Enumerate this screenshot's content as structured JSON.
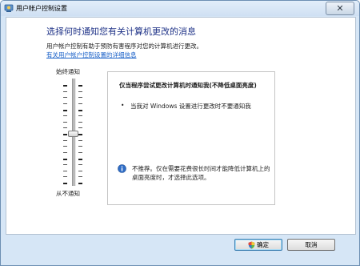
{
  "window": {
    "title": "用户帐户控制设置"
  },
  "titlebar": {
    "close_symbol": "✕"
  },
  "main": {
    "heading": "选择何时通知您有关计算机更改的消息",
    "description": "用户帐户控制有助于预防有害程序对您的计算机进行更改。",
    "more_link": "有关用户帐户控制设置的详细信息"
  },
  "slider": {
    "top_label": "始终通知",
    "bottom_label": "从不通知",
    "levels": 4,
    "current_level": 2
  },
  "panel": {
    "title": "仅当程序尝试更改计算机时通知我(不降低桌面亮度)",
    "bullet_symbol": "•",
    "bullet_text": "当我对 Windows 设置进行更改时不要通知我",
    "info_line1": "不推荐。仅在需要花费很长时间才能降低计算机上的",
    "info_line2": "桌面亮度时，才选择此选项。"
  },
  "buttons": {
    "ok": "确定",
    "cancel": "取消"
  },
  "icons": {
    "title": "control-panel-icon",
    "close": "close-icon",
    "info": "info-icon",
    "ok_shield": "uac-shield-icon"
  }
}
